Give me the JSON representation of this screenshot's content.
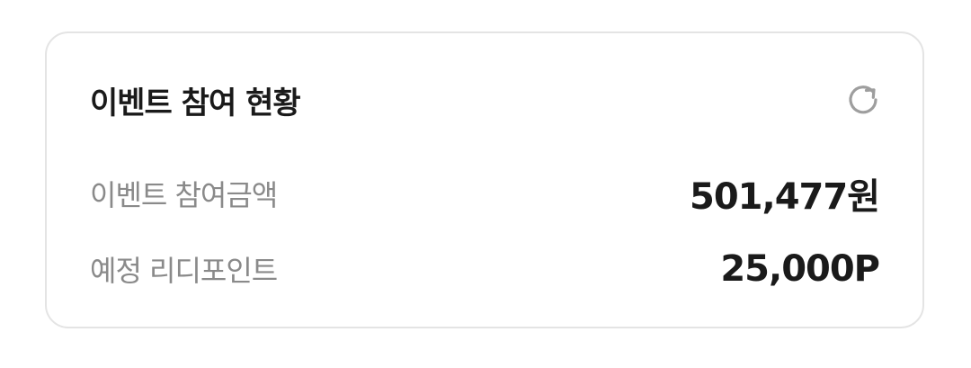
{
  "card": {
    "title": "이벤트 참여 현황",
    "refresh_icon": "refresh-icon",
    "rows": [
      {
        "label": "이벤트 참여금액",
        "value": "501,477원"
      },
      {
        "label": "예정 리디포인트",
        "value": "25,000P"
      }
    ]
  },
  "colors": {
    "title": "#1a1a1a",
    "label": "#8a8a8a",
    "value": "#1a1a1a",
    "border": "#e4e4e4",
    "icon": "#9e9e9e"
  }
}
